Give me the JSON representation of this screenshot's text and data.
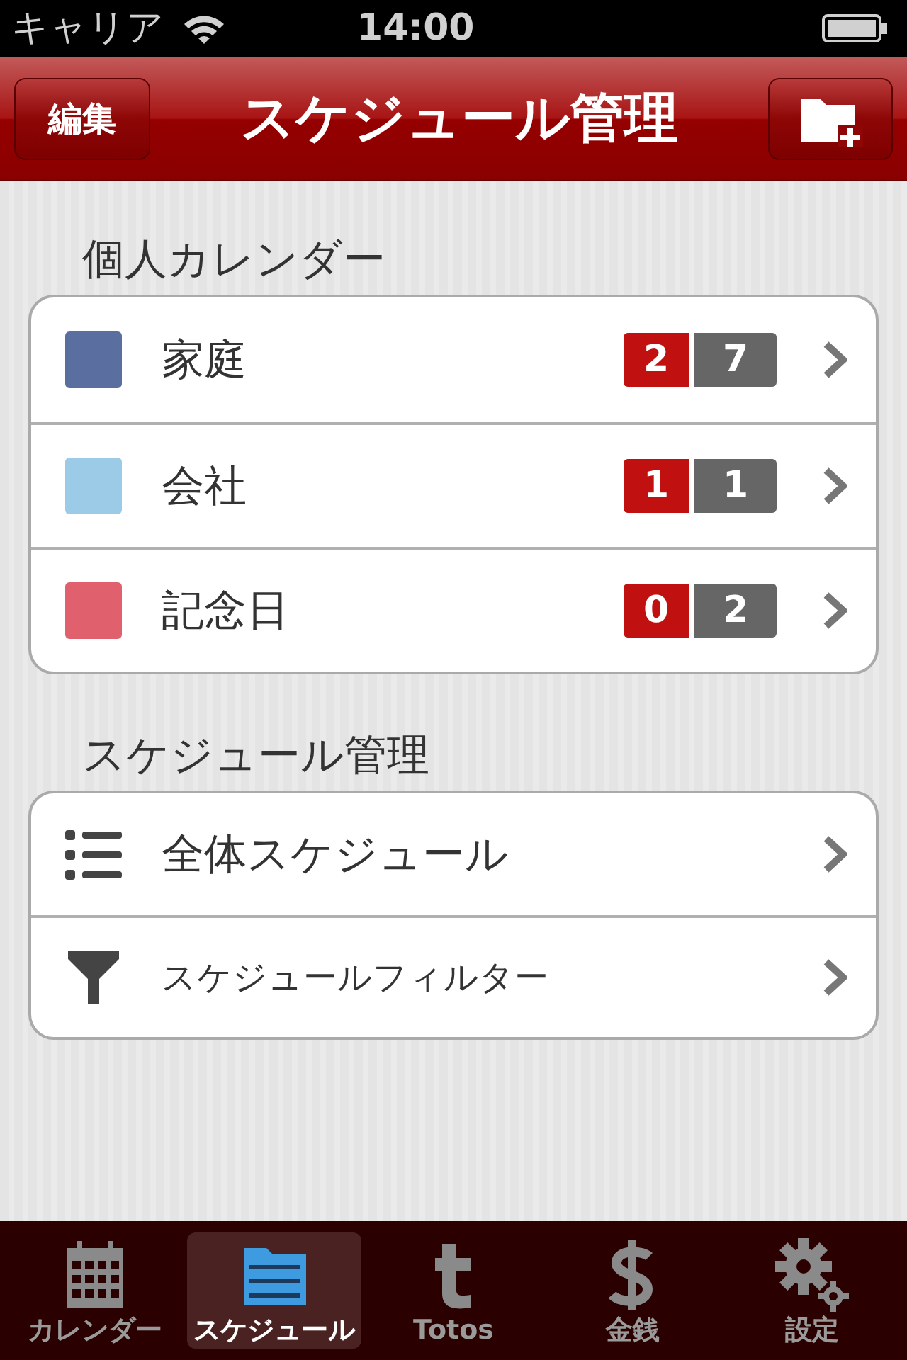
{
  "status_bar": {
    "carrier": "キャリア",
    "time": "14:00"
  },
  "nav_bar": {
    "edit_button": "編集",
    "title": "スケジュール管理"
  },
  "calendars_section": {
    "header": "個人カレンダー",
    "items": [
      {
        "name": "家庭",
        "color": "#5a6fa0",
        "count_red": "2",
        "count_gray": "7"
      },
      {
        "name": "会社",
        "color": "#9ccbe8",
        "count_red": "1",
        "count_gray": "1"
      },
      {
        "name": "記念日",
        "color": "#e0606e",
        "count_red": "0",
        "count_gray": "2"
      }
    ]
  },
  "schedule_section": {
    "header": "スケジュール管理",
    "items": [
      {
        "kind": "list",
        "label": "全体スケジュール"
      },
      {
        "kind": "filter",
        "label": "スケジュールフィルター"
      }
    ]
  },
  "tab_bar": [
    {
      "kind": "calendar",
      "label": "カレンダー",
      "selected": false
    },
    {
      "kind": "folder",
      "label": "スケジュール",
      "selected": true
    },
    {
      "kind": "letter",
      "label": "Totos",
      "selected": false
    },
    {
      "kind": "dollar",
      "label": "金銭",
      "selected": false
    },
    {
      "kind": "gear",
      "label": "設定",
      "selected": false
    }
  ]
}
